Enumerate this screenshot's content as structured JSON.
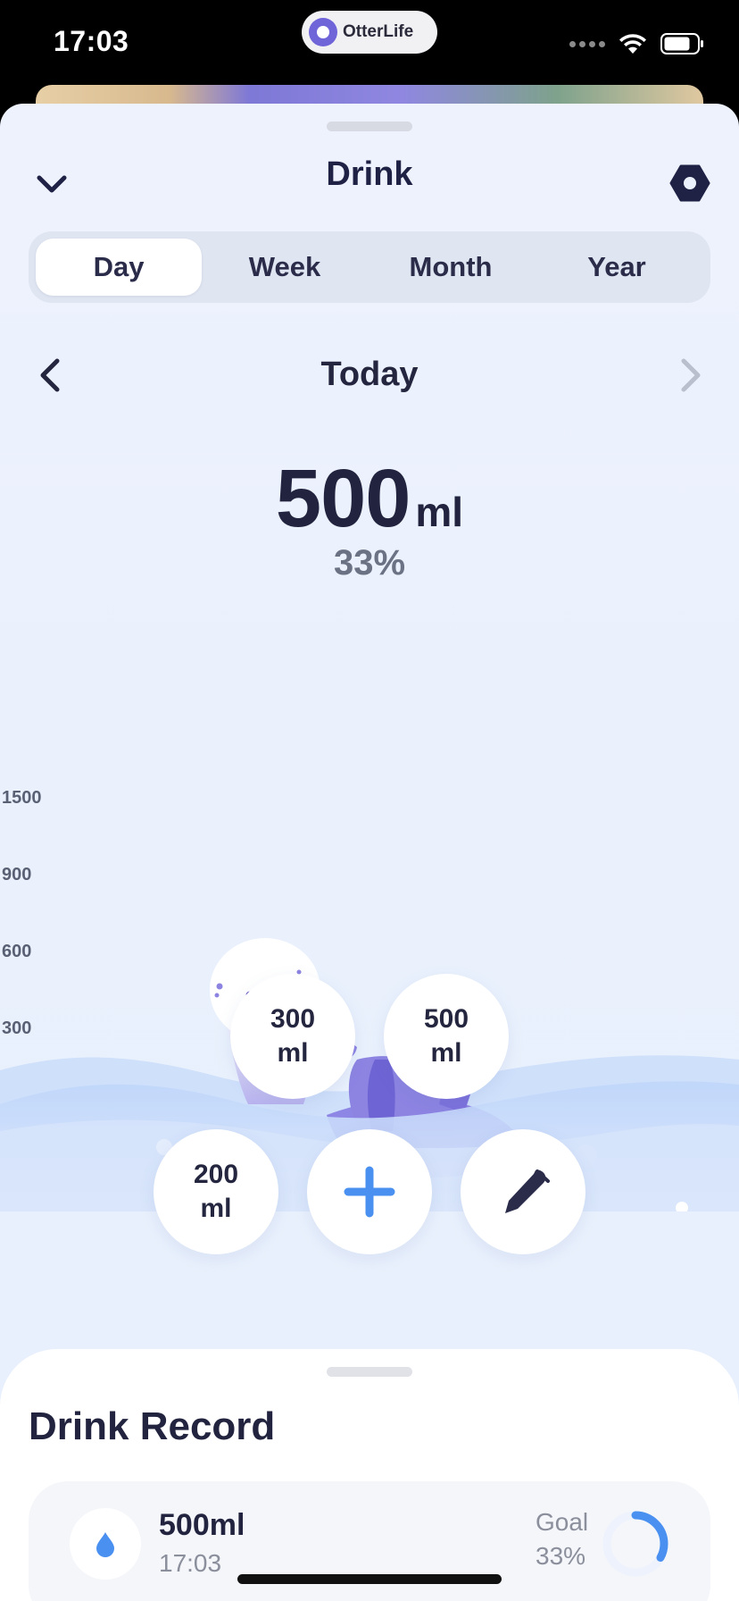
{
  "status_bar": {
    "time": "17:03",
    "island_app_name": "OtterLife"
  },
  "header": {
    "title": "Drink"
  },
  "period_tabs": [
    {
      "label": "Day",
      "active": true
    },
    {
      "label": "Week",
      "active": false
    },
    {
      "label": "Month",
      "active": false
    },
    {
      "label": "Year",
      "active": false
    }
  ],
  "date_nav": {
    "label": "Today"
  },
  "summary": {
    "amount": "500",
    "unit": "ml",
    "percent": "33%"
  },
  "scale_labels": [
    "1500",
    "900",
    "600",
    "300"
  ],
  "quick_add": {
    "btn_300": "300\nml",
    "btn_500": "500\nml",
    "btn_200": "200\nml"
  },
  "record": {
    "title": "Drink Record",
    "items": [
      {
        "amount": "500ml",
        "time": "17:03",
        "goal_label": "Goal",
        "goal_percent": "33%",
        "goal_fraction": 0.33
      }
    ]
  },
  "colors": {
    "accent_blue": "#4a90f0",
    "title_navy": "#1f2145",
    "otter_purple": "#7d72dc"
  },
  "icons": {
    "back": "chevron-down-icon",
    "settings": "hexagon-settings-icon",
    "prev": "chevron-left-icon",
    "next": "chevron-right-icon",
    "plus": "plus-icon",
    "edit": "pen-icon",
    "drop": "water-drop-icon"
  }
}
